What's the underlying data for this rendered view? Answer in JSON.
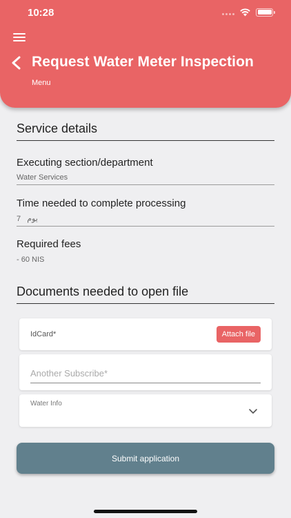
{
  "status_bar": {
    "time": "10:28"
  },
  "header": {
    "title": "Request Water Meter Inspection",
    "subtitle": "Menu",
    "bg_color": "#e96465"
  },
  "service_details": {
    "heading": "Service details",
    "fields": [
      {
        "label": "Executing section/department",
        "value": "Water Services"
      },
      {
        "label": "Time needed to complete processing",
        "value": "7   يوم"
      },
      {
        "label": "Required fees",
        "value": "- 60 NIS"
      }
    ]
  },
  "documents": {
    "heading": "Documents needed to open file",
    "id_card": {
      "label": "IdCard*",
      "button_label": "Attach file"
    },
    "another_subscribe": {
      "placeholder": "Another Subscribe*",
      "value": ""
    },
    "water_info": {
      "label": "Water Info",
      "selected": ""
    }
  },
  "submit": {
    "label": "Submit application",
    "color": "#61808d"
  },
  "icons": [
    "hamburger-icon",
    "back-icon",
    "chevron-down-icon",
    "wifi-icon",
    "battery-icon",
    "signal-icon"
  ]
}
